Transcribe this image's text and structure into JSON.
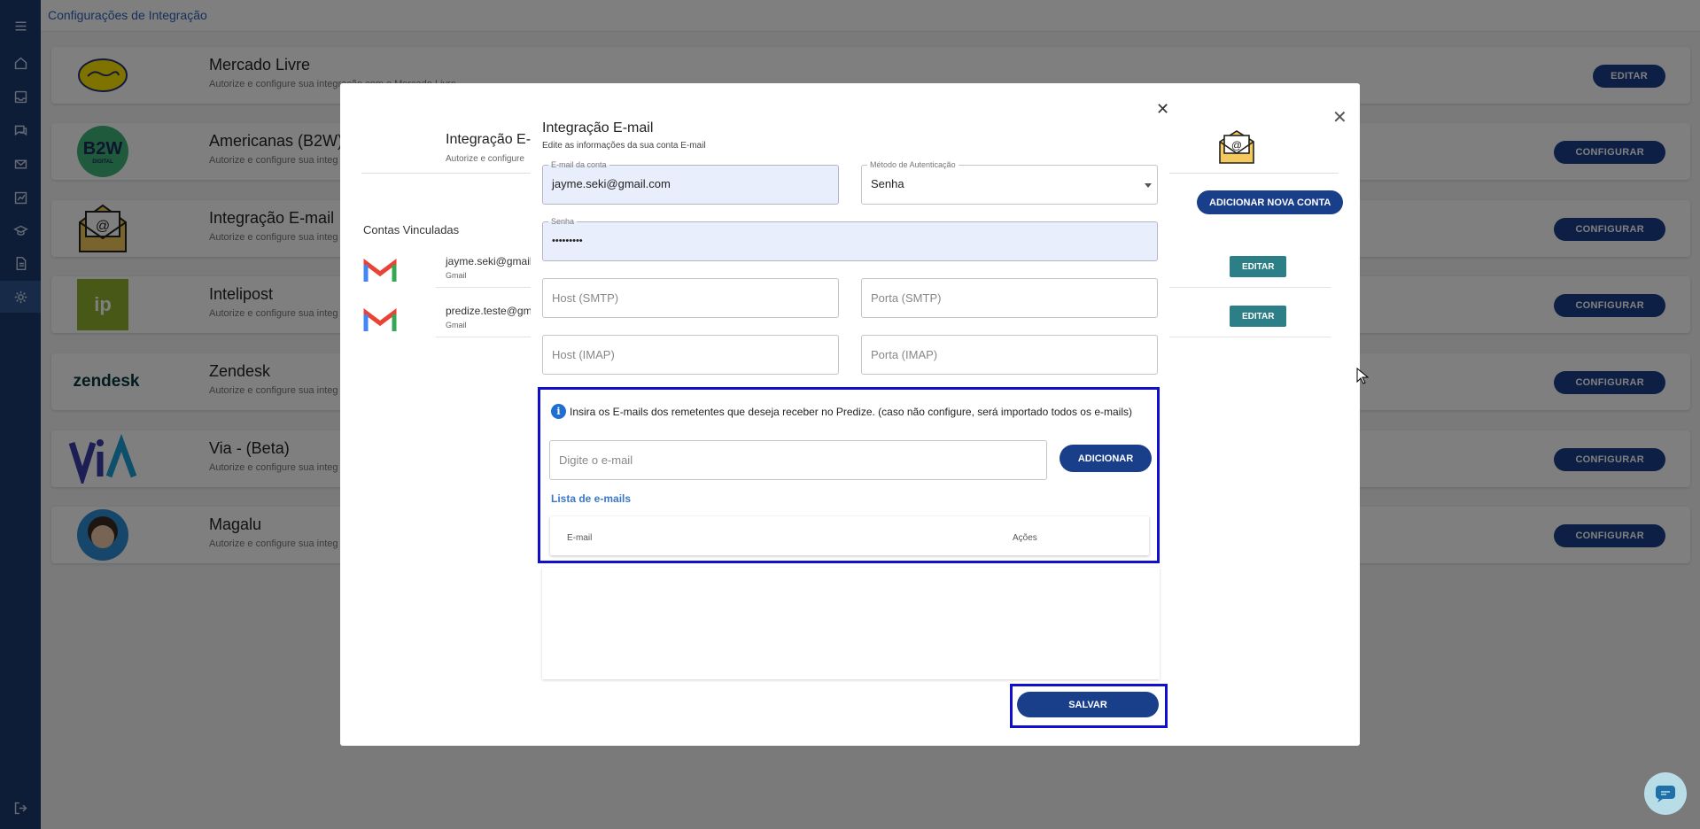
{
  "app": {
    "title": "Configurações de Integração"
  },
  "sidebar": {
    "icons": [
      "menu-icon",
      "home-icon",
      "inbox-icon",
      "chat-icon",
      "mail-icon",
      "chart-icon",
      "graduation-icon",
      "document-icon",
      "gear-icon",
      "logout-icon"
    ]
  },
  "integrations": [
    {
      "name": "Mercado Livre",
      "desc": "Autorize e configure sua integração com o Mercado Livre",
      "action": "EDITAR"
    },
    {
      "name": "Americanas (B2W)",
      "desc": "Autorize e configure sua integ",
      "action": "CONFIGURAR"
    },
    {
      "name": "Integração E-mail",
      "desc": "Autorize e configure sua integ",
      "action": "CONFIGURAR"
    },
    {
      "name": "Intelipost",
      "desc": "Autorize e configure sua integ",
      "action": "CONFIGURAR"
    },
    {
      "name": "Zendesk",
      "desc": "Autorize e configure sua integ",
      "action": "CONFIGURAR"
    },
    {
      "name": "Via - (Beta)",
      "desc": "Autorize e configure sua integ",
      "action": "CONFIGURAR"
    },
    {
      "name": "Magalu",
      "desc": "Autorize e configure sua integ",
      "action": "CONFIGURAR"
    }
  ],
  "logos": {
    "b2w_top": "B2W",
    "b2w_bottom": "DIGITAL",
    "intelipost": "ip",
    "zendesk": "zendesk",
    "via": "vi/a"
  },
  "mid_dialog": {
    "title": "Integração E-",
    "subtitle": "Autorize e configure",
    "add_account_label": "ADICIONAR NOVA CONTA",
    "linked_title": "Contas Vinculadas",
    "accounts": [
      {
        "email": "jayme.seki@gmail",
        "provider": "Gmail",
        "edit_label": "EDITAR"
      },
      {
        "email": "predize.teste@gm",
        "provider": "Gmail",
        "edit_label": "EDITAR"
      }
    ]
  },
  "email_dialog": {
    "title": "Integração E-mail",
    "subtitle": "Edite as informações da sua conta E-mail",
    "account_email": {
      "label": "E-mail da conta",
      "value": "jayme.seki@gmail.com"
    },
    "auth_method": {
      "label": "Método de Autenticação",
      "value": "Senha"
    },
    "password": {
      "label": "Senha",
      "value": "•••••••••"
    },
    "smtp_host": {
      "placeholder": "Host (SMTP)"
    },
    "smtp_port": {
      "placeholder": "Porta (SMTP)"
    },
    "imap_host": {
      "placeholder": "Host (IMAP)"
    },
    "imap_port": {
      "placeholder": "Porta (IMAP)"
    },
    "info_text": "Insira os E-mails dos remetentes que deseja receber no Predize. (caso não configure, será importado todos os e-mails)",
    "new_email_placeholder": "Digite o e-mail",
    "add_label": "ADICIONAR",
    "list_title": "Lista de e-mails",
    "table_headers": [
      "E-mail",
      "Ações"
    ],
    "save_label": "SALVAR"
  },
  "colors": {
    "primary": "#1a3f8a",
    "sidebar": "#1c3b6e",
    "edit_teal": "#2c7f86",
    "highlight": "#1010cc",
    "link": "#3a78c9"
  }
}
